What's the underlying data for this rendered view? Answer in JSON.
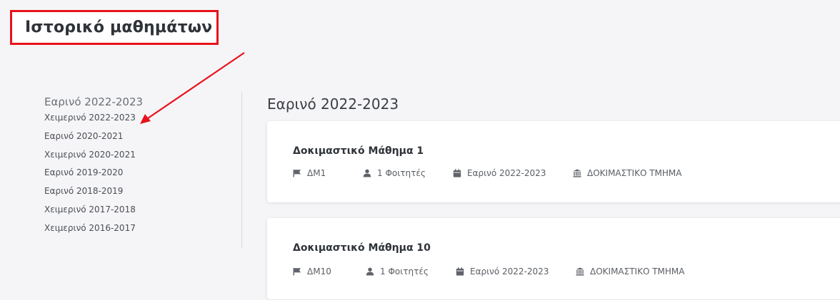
{
  "header": {
    "title": "Ιστορικό μαθημάτων"
  },
  "sidebar": {
    "items": [
      {
        "label": "Εαρινό 2022-2023",
        "active": true
      },
      {
        "label": "Χειμερινό 2022-2023"
      },
      {
        "label": "Εαρινό 2020-2021"
      },
      {
        "label": "Χειμερινό 2020-2021"
      },
      {
        "label": "Εαρινό 2019-2020"
      },
      {
        "label": "Εαρινό 2018-2019"
      },
      {
        "label": "Χειμερινό 2017-2018"
      },
      {
        "label": "Χειμερινό 2016-2017"
      }
    ]
  },
  "main": {
    "section_title": "Εαρινό 2022-2023",
    "courses": [
      {
        "name": "Δοκιμαστικό Μάθημα 1",
        "code": "ΔΜ1",
        "students": "1 Φοιτητές",
        "semester": "Εαρινό 2022-2023",
        "department": "ΔΟΚΙΜΑΣΤΙΚΟ ΤΜΗΜΑ"
      },
      {
        "name": "Δοκιμαστικό Μάθημα 10",
        "code": "ΔΜ10",
        "students": "1 Φοιτητές",
        "semester": "Εαρινό 2022-2023",
        "department": "ΔΟΚΙΜΑΣΤΙΚΟ ΤΜΗΜΑ"
      }
    ]
  },
  "colors": {
    "highlight": "#e8121b",
    "background": "#f5f5f7",
    "card": "#ffffff",
    "icon": "#5f6369"
  }
}
